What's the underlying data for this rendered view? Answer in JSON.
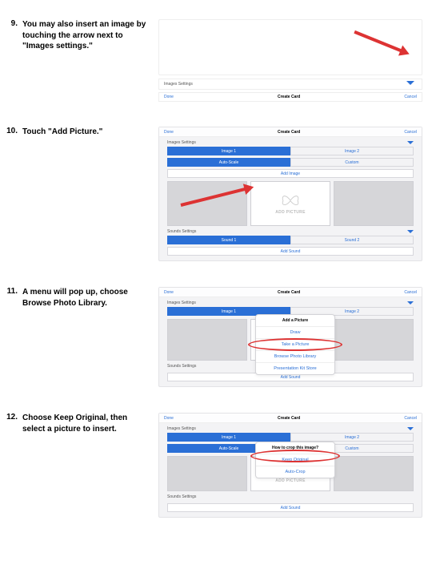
{
  "steps": {
    "s9": {
      "num": "9.",
      "text": "You may also insert an image by touching the arrow next to \"Images settings.\""
    },
    "s10": {
      "num": "10.",
      "text": "Touch \"Add Picture.\""
    },
    "s11": {
      "num": "11.",
      "text": "A menu will pop up, choose Browse Photo Library."
    },
    "s12": {
      "num": "12.",
      "text": "Choose Keep Original, then select a picture to insert."
    }
  },
  "hdr": {
    "done": "Done",
    "cancel": "Cancel",
    "title": "Create Card"
  },
  "sections": {
    "imagesSettings": "Images Settings",
    "soundsSettings": "Sounds Settings"
  },
  "row1": {
    "left": "Image 1",
    "right": "Image 2"
  },
  "row2": {
    "left": "Auto-Scale",
    "right": "Custom"
  },
  "links": {
    "addImage": "Add Image",
    "addSound": "Add Sound"
  },
  "row3": {
    "left": "Sound 1",
    "right": "Sound 2"
  },
  "addPicture": {
    "label": "ADD PICTURE"
  },
  "popup11": {
    "title": "Add a Picture",
    "opt1": "Draw",
    "opt2": "Take a Picture",
    "opt3": "Browse Photo Library",
    "opt4": "Presentation Kit Store"
  },
  "popup12": {
    "title": "How to crop this image?",
    "opt1": "Keep Original",
    "opt2": "Auto-Crop"
  }
}
